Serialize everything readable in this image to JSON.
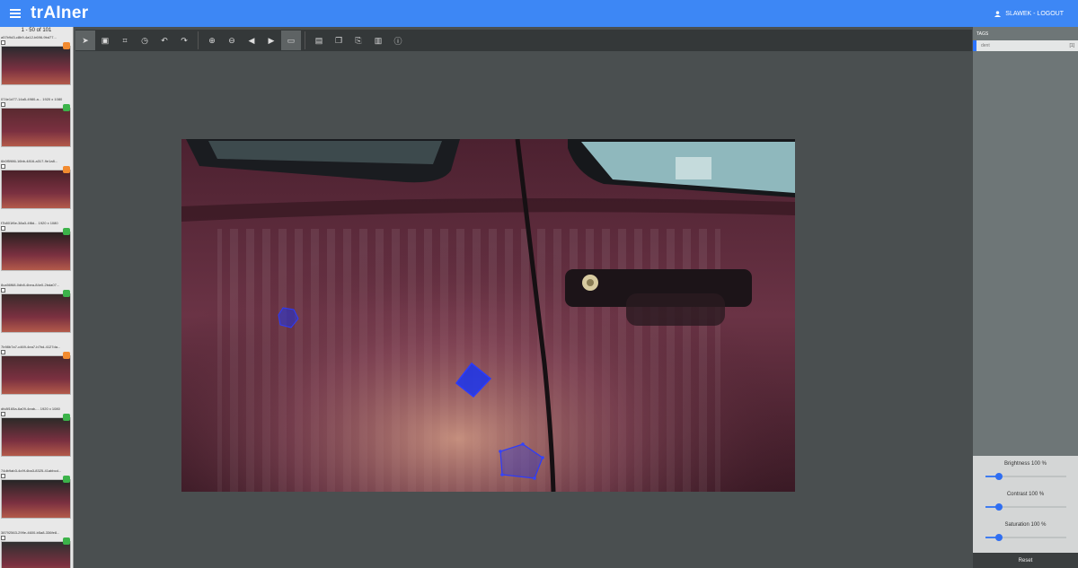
{
  "app": {
    "title": "trAIner",
    "user_label": "SLAWEK - LOGOUT"
  },
  "icons": {
    "menu": "menu-icon",
    "user": "user-icon"
  },
  "sidebar": {
    "pager": "1 - 50 of 101",
    "items": [
      {
        "name": "a57b9d3-c8b9-4a12-b696-9bd77...",
        "status": "orange"
      },
      {
        "name": "074e1d77-14a5-4980-a...  1920 x 1080",
        "status": "green"
      },
      {
        "name": "6b0f5986-16bb-4816-a317-9e1a8...",
        "status": "orange"
      },
      {
        "name": "f7b801f6e-38a3-4f8d...  1920 x 1080",
        "status": "green"
      },
      {
        "name": "8ca56f68-0db8-4bea-84e0-2bda07...",
        "status": "green"
      },
      {
        "name": "7b98b7a7-c469-4ea7-b7bd-4127da...",
        "status": "orange"
      },
      {
        "name": "dfc8f165a-6a09-4eab-...  1920 x 1080",
        "status": "green"
      },
      {
        "name": "74db9ab3-4c9f-4ba3-8325-41abbcd...",
        "status": "green"
      },
      {
        "name": "38792563-299e-4600-b5a8-336fe8...",
        "status": "green"
      }
    ]
  },
  "toolbar": {
    "groups": [
      [
        "pointer-icon",
        "select-region-icon",
        "crop-icon",
        "history-icon",
        "undo-icon",
        "redo-icon"
      ],
      [
        "zoom-in-icon",
        "zoom-out-icon",
        "prev-icon",
        "next-icon",
        "fit-icon"
      ],
      [
        "save-icon",
        "copy-icon",
        "paste-icon",
        "delete-icon",
        "info-icon"
      ]
    ]
  },
  "tags": {
    "title": "TAGS",
    "items": [
      {
        "label": "dent",
        "count": "[1]"
      }
    ]
  },
  "adjustments": {
    "brightness": {
      "label": "Brightness 100 %",
      "value": 100
    },
    "contrast": {
      "label": "Contrast 100 %",
      "value": 100
    },
    "saturation": {
      "label": "Saturation 100 %",
      "value": 100
    },
    "reset_label": "Reset"
  },
  "colors": {
    "accent": "#3d87f5",
    "annotation": "#2233dd",
    "car": "#5a2a3a"
  }
}
